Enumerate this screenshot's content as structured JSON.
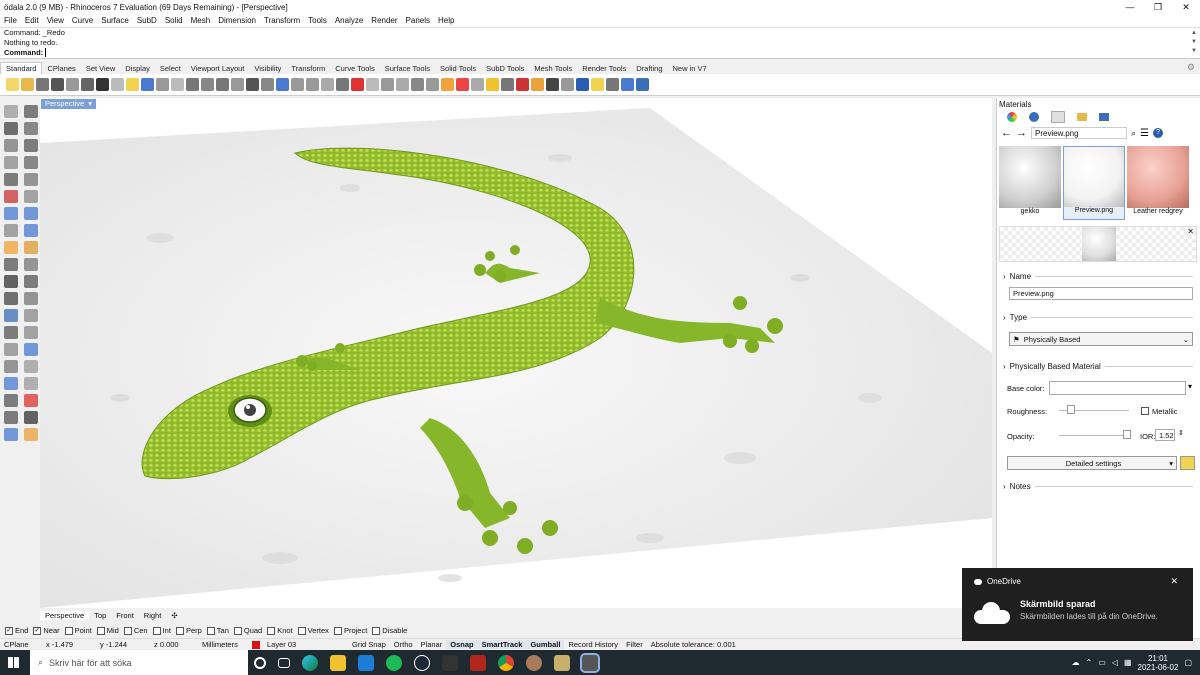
{
  "window": {
    "title": "ödala 2.0 (9 MB) - Rhinoceros 7 Evaluation (69 Days Remaining) - [Perspective]",
    "minimize": "—",
    "maximize": "❐",
    "close": "✕"
  },
  "menu": [
    "File",
    "Edit",
    "View",
    "Curve",
    "Surface",
    "SubD",
    "Solid",
    "Mesh",
    "Dimension",
    "Transform",
    "Tools",
    "Analyze",
    "Render",
    "Panels",
    "Help"
  ],
  "command": {
    "line1": "Command: _Redo",
    "line2": "Nothing to redo.",
    "prompt": "Command:"
  },
  "tabs": [
    "Standard",
    "CPlanes",
    "Set View",
    "Display",
    "Select",
    "Viewport Layout",
    "Visibility",
    "Transform",
    "Curve Tools",
    "Surface Tools",
    "Solid Tools",
    "SubD Tools",
    "Mesh Tools",
    "Render Tools",
    "Drafting",
    "New in V7"
  ],
  "toolbar_colors": [
    "#f5d66b",
    "#e8b84a",
    "#777",
    "#555",
    "#999",
    "#666",
    "#333",
    "#bbb",
    "#f2d34f",
    "#4a7bd1",
    "#999",
    "#bbb",
    "#777",
    "#888",
    "#777",
    "#999",
    "#555",
    "#888",
    "#4a7bd1",
    "#999",
    "#999",
    "#aaa",
    "#777",
    "#d33",
    "#bbb",
    "#999",
    "#aaa",
    "#888",
    "#999",
    "#f2a23a",
    "#e44",
    "#aaa",
    "#f2c12e",
    "#777",
    "#c33",
    "#e9a23b",
    "#444",
    "#999",
    "#2a5db0",
    "#f2d34f",
    "#777",
    "#4a7bd1",
    "#3a6fb8"
  ],
  "viewport": {
    "label": "Perspective",
    "dropdown": "▾"
  },
  "viewport_tabs": [
    "Perspective",
    "Top",
    "Front",
    "Right",
    "✣"
  ],
  "osnap": [
    {
      "label": "End",
      "checked": true
    },
    {
      "label": "Near",
      "checked": true
    },
    {
      "label": "Point",
      "checked": false
    },
    {
      "label": "Mid",
      "checked": false
    },
    {
      "label": "Cen",
      "checked": false
    },
    {
      "label": "Int",
      "checked": false
    },
    {
      "label": "Perp",
      "checked": false
    },
    {
      "label": "Tan",
      "checked": false
    },
    {
      "label": "Quad",
      "checked": false
    },
    {
      "label": "Knot",
      "checked": false
    },
    {
      "label": "Vertex",
      "checked": false
    },
    {
      "label": "Project",
      "checked": false
    },
    {
      "label": "Disable",
      "checked": false
    }
  ],
  "status": {
    "cplane": "CPlane",
    "x": "x -1.479",
    "y": "y -1.244",
    "z": "z 0.000",
    "units": "Millimeters",
    "layer": "Layer 03",
    "layer_color": "#d11",
    "grid": "Grid Snap",
    "ortho": "Ortho",
    "planar": "Planar",
    "osnap": "Osnap",
    "smarttrack": "SmartTrack",
    "gumball": "Gumball",
    "history": "Record History",
    "filter": "Filter",
    "tolerance": "Absolute tolerance: 0.001"
  },
  "panel": {
    "title": "Materials",
    "path": "Preview.png",
    "thumbs": [
      {
        "label": "gekko",
        "color": "#cfcfcf"
      },
      {
        "label": "Preview.png",
        "color": "#f2f2f2"
      },
      {
        "label": "Leather redgrey",
        "color": "#e7a195"
      }
    ],
    "name_section": "Name",
    "name_value": "Preview.png",
    "type_section": "Type",
    "type_value": "Physically Based",
    "pbm_section": "Physically Based Material",
    "base_color": "Base color:",
    "roughness": "Roughness:",
    "metallic": "Metallic",
    "opacity": "Opacity:",
    "ior_label": "IOR:",
    "ior_value": "1.52",
    "detailed": "Detailed settings",
    "notes": "Notes"
  },
  "toast": {
    "app": "OneDrive",
    "title": "Skärmbild sparad",
    "body": "Skärmbilden lades till på din OneDrive."
  },
  "taskbar": {
    "search": "Skriv här för att söka",
    "time": "21:01",
    "date": "2021-06-02"
  }
}
